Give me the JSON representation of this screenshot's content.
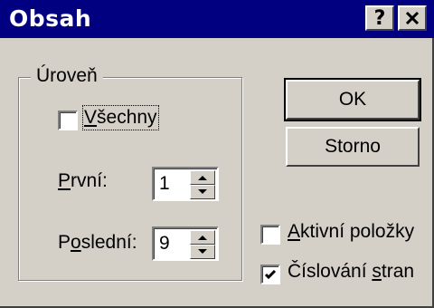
{
  "window": {
    "title": "Obsah",
    "help_glyph": "?",
    "close_icon": "close-icon"
  },
  "group": {
    "label": "Úroveň",
    "all_checkbox": {
      "label_pre": "",
      "label_ul": "V",
      "label_post": "šechny",
      "checked": false
    },
    "first": {
      "label_pre": "",
      "label_ul": "P",
      "label_post": "rvní:",
      "value": "1"
    },
    "last": {
      "label_pre": "P",
      "label_ul": "o",
      "label_post": "slední:",
      "value": "9"
    }
  },
  "buttons": {
    "ok": "OK",
    "cancel": "Storno"
  },
  "options": {
    "active_items": {
      "label_pre": "",
      "label_ul": "A",
      "label_post": "ktivní položky",
      "checked": false
    },
    "page_numbers": {
      "label_pre": "Číslování ",
      "label_ul": "s",
      "label_post": "tran",
      "checked": true
    }
  },
  "colors": {
    "titlebar": "#000080",
    "face": "#d4d0c8"
  }
}
